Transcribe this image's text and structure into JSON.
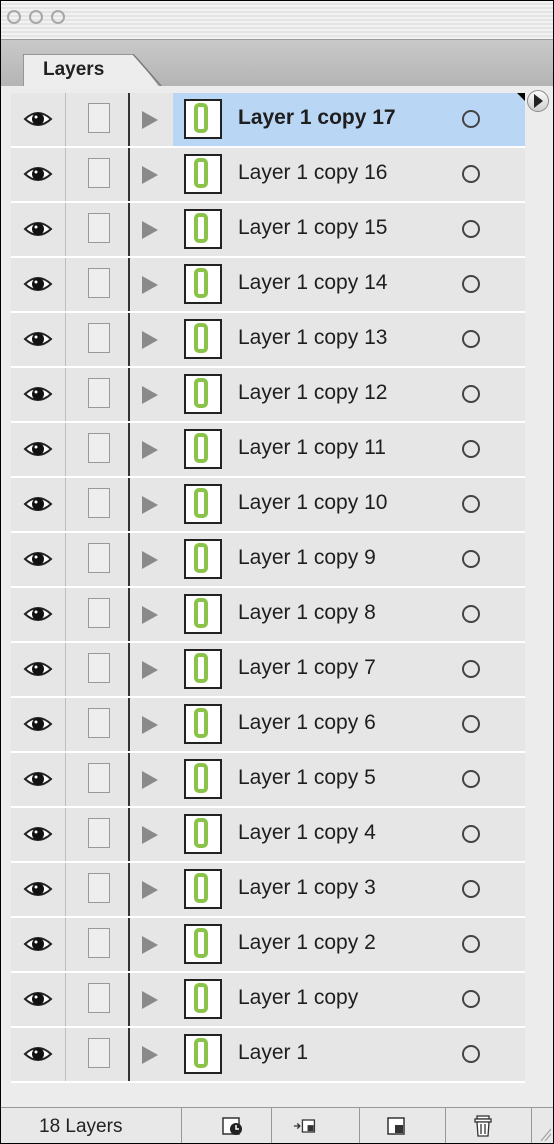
{
  "panel": {
    "tab_label": "Layers",
    "status_text": "18 Layers"
  },
  "layers": [
    {
      "name": "Layer 1 copy 17",
      "selected": true
    },
    {
      "name": "Layer 1 copy 16",
      "selected": false
    },
    {
      "name": "Layer 1 copy 15",
      "selected": false
    },
    {
      "name": "Layer 1 copy 14",
      "selected": false
    },
    {
      "name": "Layer 1 copy 13",
      "selected": false
    },
    {
      "name": "Layer 1 copy 12",
      "selected": false
    },
    {
      "name": "Layer 1 copy 11",
      "selected": false
    },
    {
      "name": "Layer 1 copy 10",
      "selected": false
    },
    {
      "name": "Layer 1 copy 9",
      "selected": false
    },
    {
      "name": "Layer 1 copy 8",
      "selected": false
    },
    {
      "name": "Layer 1 copy 7",
      "selected": false
    },
    {
      "name": "Layer 1 copy 6",
      "selected": false
    },
    {
      "name": "Layer 1 copy 5",
      "selected": false
    },
    {
      "name": "Layer 1 copy 4",
      "selected": false
    },
    {
      "name": "Layer 1 copy 3",
      "selected": false
    },
    {
      "name": "Layer 1 copy 2",
      "selected": false
    },
    {
      "name": "Layer 1 copy",
      "selected": false
    },
    {
      "name": "Layer 1",
      "selected": false
    }
  ],
  "icons": {
    "visibility": "eye-icon",
    "expand": "disclosure-triangle-icon",
    "thumbnail": "layer-thumbnail-icon",
    "target": "layer-target-circle-icon",
    "footer": [
      "new-group-from-layers-icon",
      "new-layer-set-icon",
      "new-layer-icon",
      "trash-icon"
    ]
  },
  "colors": {
    "selection": "#b9d6f5",
    "thumb_accent": "#8bc34a"
  }
}
